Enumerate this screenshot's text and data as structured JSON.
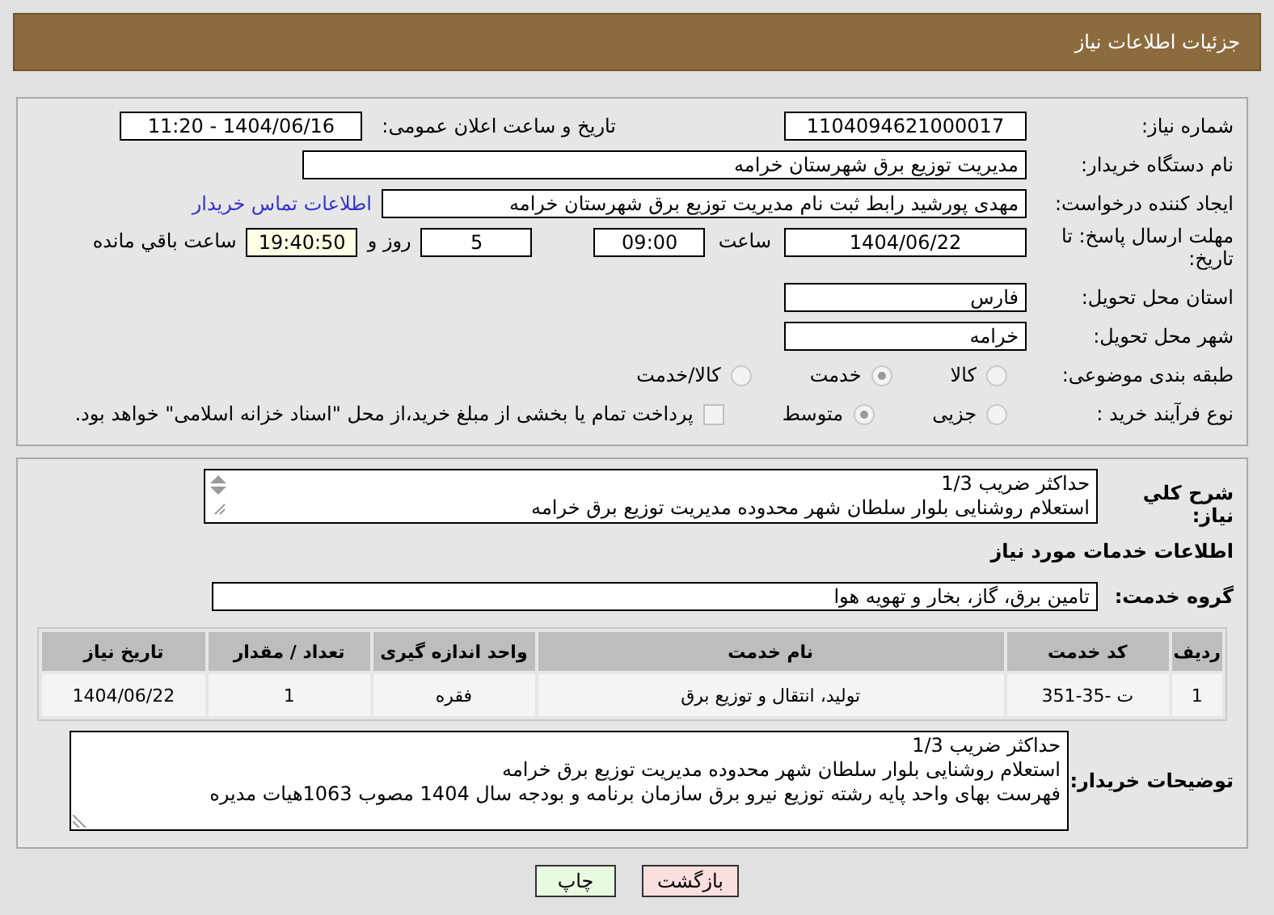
{
  "header": {
    "title": "جزئیات اطلاعات نیاز"
  },
  "need_number": {
    "label": "شماره نیاز:",
    "value": "1104094621000017"
  },
  "announce": {
    "label": "تاریخ و ساعت اعلان عمومی:",
    "value": "1404/06/16 - 11:20"
  },
  "buyer": {
    "label": "نام دستگاه خریدار:",
    "value": "مدیریت توزیع برق شهرستان خرامه"
  },
  "creator": {
    "label": "ایجاد کننده درخواست:",
    "value": "مهدی پورشید رابط ثبت نام مدیریت توزیع برق شهرستان خرامه",
    "link": "اطلاعات تماس خریدار"
  },
  "deadline": {
    "label": "مهلت ارسال پاسخ: تا تاریخ:",
    "date": "1404/06/22",
    "time_label": "ساعت",
    "time": "09:00",
    "days": "5",
    "days_label": "روز و",
    "remaining": "19:40:50",
    "remaining_label": "ساعت باقي مانده"
  },
  "province": {
    "label": "استان محل تحویل:",
    "value": "فارس"
  },
  "city": {
    "label": "شهر محل تحویل:",
    "value": "خرامه"
  },
  "category": {
    "label": "طبقه بندی موضوعی:",
    "options": [
      {
        "label": "کالا",
        "selected": false
      },
      {
        "label": "خدمت",
        "selected": true
      },
      {
        "label": "کالا/خدمت",
        "selected": false
      }
    ]
  },
  "process": {
    "label": "نوع فرآیند خرید :",
    "options": [
      {
        "label": "جزیی",
        "selected": false
      },
      {
        "label": "متوسط",
        "selected": true
      }
    ],
    "payment": {
      "checked": false,
      "label": "پرداخت تمام یا بخشی از مبلغ خرید،از محل \"اسناد خزانه اسلامی\" خواهد بود."
    }
  },
  "summary": {
    "label": "شرح کلي نیاز:",
    "value": "حداکثر ضریب 1/3\nاستعلام روشنایی بلوار سلطان شهر محدوده مدیریت توزیع برق خرامه"
  },
  "services_heading": "اطلاعات خدمات مورد نیاز",
  "service_group": {
    "label": "گروه خدمت:",
    "value": "تامین برق، گاز، بخار و تهویه هوا"
  },
  "table": {
    "columns": [
      "ردیف",
      "کد خدمت",
      "نام خدمت",
      "واحد اندازه گیری",
      "تعداد / مقدار",
      "تاریخ نیاز"
    ],
    "rows": [
      [
        "1",
        "ت -35-351",
        "تولید، انتقال و توزیع برق",
        "فقره",
        "1",
        "1404/06/22"
      ]
    ]
  },
  "buyer_notes": {
    "label": "توضیحات خریدار:",
    "value": "حداکثر ضریب 1/3\nاستعلام روشنایی بلوار سلطان شهر محدوده مدیریت توزیع برق خرامه\nفهرست بهای واحد پایه رشته توزیع نیرو برق سازمان برنامه و بودجه سال 1404 مصوب 1063هیات مدیره"
  },
  "buttons": [
    {
      "kind": "back",
      "label": "بازگشت"
    },
    {
      "kind": "print",
      "label": "چاپ"
    }
  ]
}
